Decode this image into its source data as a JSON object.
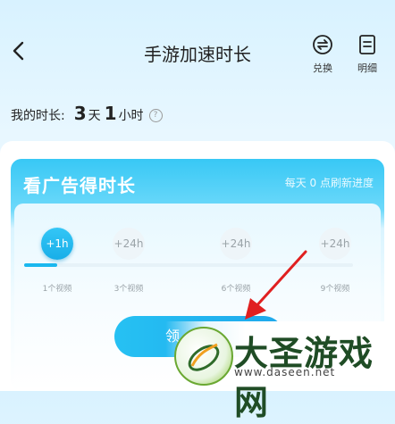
{
  "header": {
    "title": "手游加速时长",
    "exchange_label": "兑换",
    "detail_label": "明细"
  },
  "duration": {
    "label": "我的时长:",
    "days": "3",
    "day_unit": "天",
    "hours": "1",
    "hour_unit": "小时",
    "info": "?"
  },
  "ad_card": {
    "title": "看广告得时长",
    "subtitle": "每天 0 点刷新进度",
    "progress_fraction": 0.1,
    "milestones": [
      {
        "reward": "+1h",
        "caption": "1个视频",
        "done": true
      },
      {
        "reward": "+24h",
        "caption": "3个视频",
        "done": false
      },
      {
        "reward": "+24h",
        "caption": "6个视频",
        "done": false
      },
      {
        "reward": "+24h",
        "caption": "9个视频",
        "done": false
      }
    ],
    "cta_label": "领"
  },
  "watermark": {
    "brand": "大圣游戏网",
    "url": "www.daseen.net"
  },
  "colors": {
    "accent": "#1ab8ef",
    "card_top": "#38c8f5",
    "arrow": "#e02020"
  }
}
